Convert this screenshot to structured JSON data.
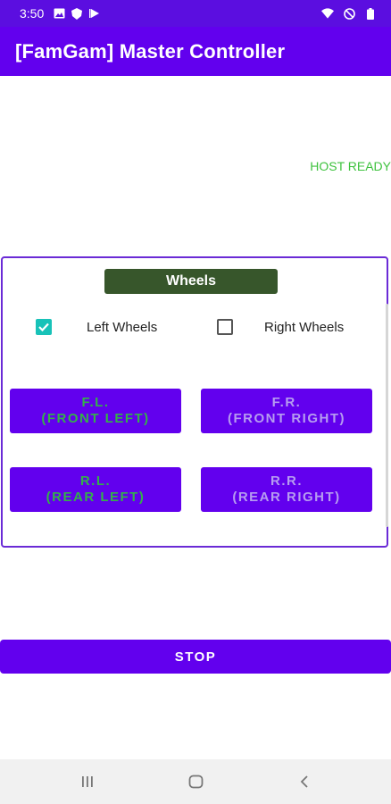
{
  "status_bar": {
    "time": "3:50",
    "left_icons": [
      "image-icon",
      "shield-icon",
      "play-icon"
    ],
    "right_icons": [
      "wifi-icon",
      "do-not-disturb-icon",
      "battery-icon"
    ]
  },
  "app_bar": {
    "title": "[FamGam] Master Controller"
  },
  "host_status": {
    "text": "HOST READY",
    "color": "#3ec23e"
  },
  "wheels_panel": {
    "title": "Wheels",
    "left_wheels": {
      "label": "Left Wheels",
      "checked": true
    },
    "right_wheels": {
      "label": "Right Wheels",
      "checked": false
    },
    "buttons": [
      {
        "line1": "F.L.",
        "line2": "(FRONT LEFT)",
        "active": true
      },
      {
        "line1": "F.R.",
        "line2": "(FRONT RIGHT)",
        "active": false
      },
      {
        "line1": "R.L.",
        "line2": "(REAR LEFT)",
        "active": true
      },
      {
        "line1": "R.R.",
        "line2": "(REAR RIGHT)",
        "active": false
      }
    ]
  },
  "stop_button": {
    "label": "STOP"
  },
  "nav_bar": {
    "icons": [
      "recents-icon",
      "home-icon",
      "back-icon"
    ]
  },
  "colors": {
    "primary": "#6200ee",
    "accent": "#18c2b8",
    "title_bg": "#37562b"
  }
}
